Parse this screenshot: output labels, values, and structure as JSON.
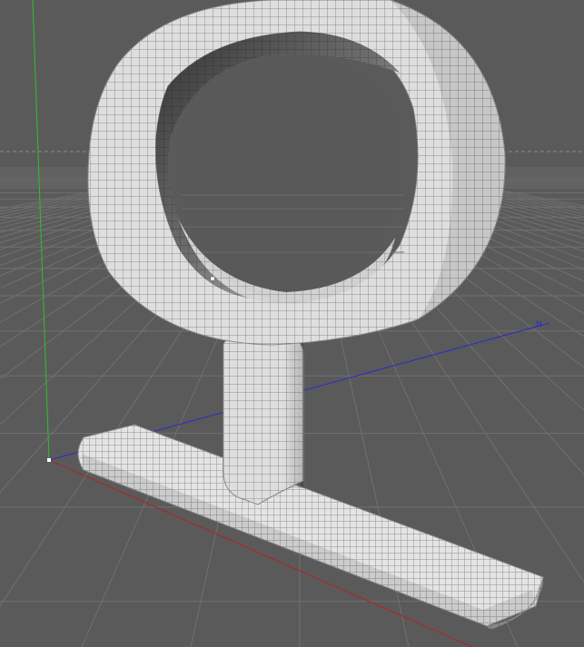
{
  "viewport": {
    "background": "#5a5a5a",
    "grid_color": "#6e6e6e",
    "horizon_color": "#8a8a8a",
    "mesh_fill": "#dcdcdc",
    "mesh_wire": "#8c8c8c",
    "mesh_shadow": "#3a3a3a"
  },
  "axes": {
    "x_color": "#b22222",
    "y_color": "#2fbf2f",
    "z_color": "#2a2ad0",
    "z_label": "N"
  },
  "model": {
    "object": "omega-symbol-mesh"
  }
}
